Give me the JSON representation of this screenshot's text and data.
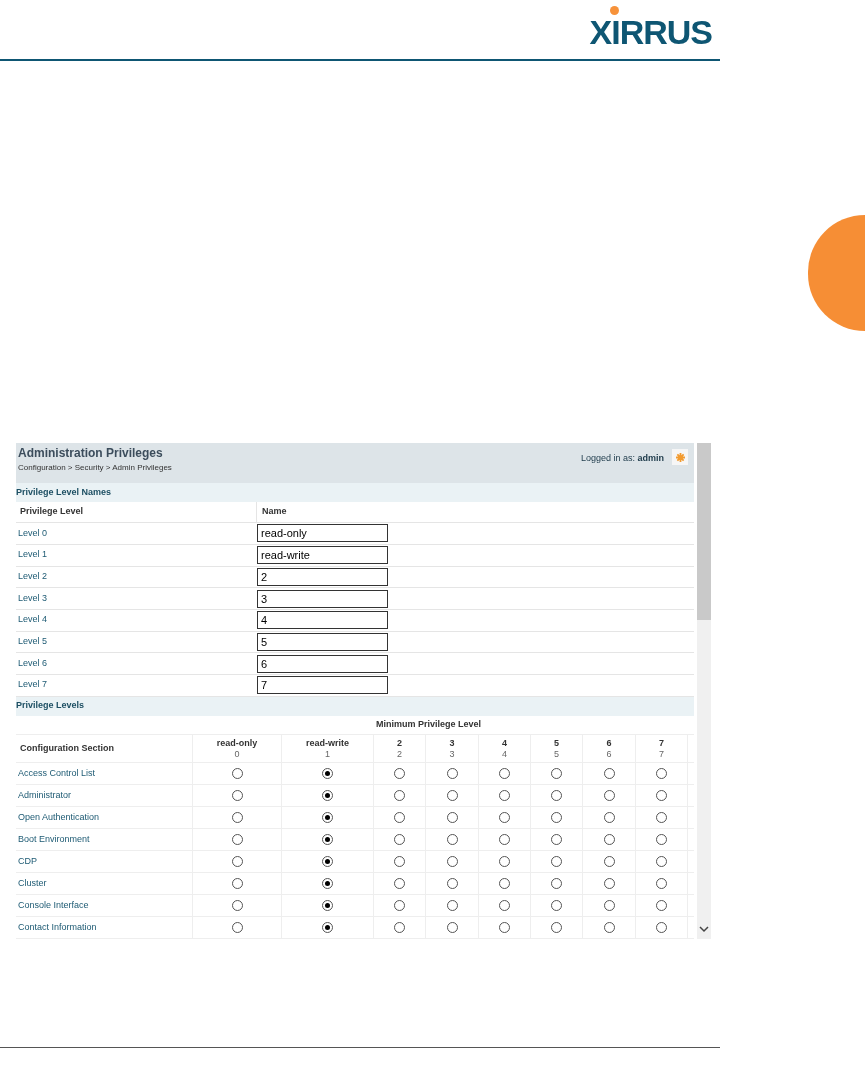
{
  "logo": "XIRRUS",
  "panel": {
    "title": "Administration Privileges",
    "breadcrumb": "Configuration > Security > Admin Privileges",
    "logged_in_label": "Logged in as:",
    "logged_in_user": "admin",
    "names_section": {
      "title": "Privilege Level Names",
      "columns": [
        "Privilege Level",
        "Name"
      ],
      "rows": [
        {
          "level": "Level 0",
          "name": "read-only"
        },
        {
          "level": "Level 1",
          "name": "read-write"
        },
        {
          "level": "Level 2",
          "name": "2"
        },
        {
          "level": "Level 3",
          "name": "3"
        },
        {
          "level": "Level 4",
          "name": "4"
        },
        {
          "level": "Level 5",
          "name": "5"
        },
        {
          "level": "Level 6",
          "name": "6"
        },
        {
          "level": "Level 7",
          "name": "7"
        }
      ]
    },
    "levels_section": {
      "title": "Privilege Levels",
      "group_header": "Minimum Privilege Level",
      "first_column": "Configuration Section",
      "columns": [
        {
          "name": "read-only",
          "number": "0"
        },
        {
          "name": "read-write",
          "number": "1"
        },
        {
          "name": "2",
          "number": "2"
        },
        {
          "name": "3",
          "number": "3"
        },
        {
          "name": "4",
          "number": "4"
        },
        {
          "name": "5",
          "number": "5"
        },
        {
          "name": "6",
          "number": "6"
        },
        {
          "name": "7",
          "number": "7"
        }
      ],
      "rows": [
        {
          "section": "Access Control List",
          "options": [
            {
              "selected": false
            },
            {
              "selected": true
            },
            {
              "selected": false
            },
            {
              "selected": false
            },
            {
              "selected": false
            },
            {
              "selected": false
            },
            {
              "selected": false
            },
            {
              "selected": false
            }
          ]
        },
        {
          "section": "Administrator",
          "options": [
            {
              "selected": false
            },
            {
              "selected": true
            },
            {
              "selected": false
            },
            {
              "selected": false
            },
            {
              "selected": false
            },
            {
              "selected": false
            },
            {
              "selected": false
            },
            {
              "selected": false
            }
          ]
        },
        {
          "section": "Open Authentication",
          "options": [
            {
              "selected": false
            },
            {
              "selected": true
            },
            {
              "selected": false
            },
            {
              "selected": false
            },
            {
              "selected": false
            },
            {
              "selected": false
            },
            {
              "selected": false
            },
            {
              "selected": false
            }
          ]
        },
        {
          "section": "Boot Environment",
          "options": [
            {
              "selected": false
            },
            {
              "selected": true
            },
            {
              "selected": false
            },
            {
              "selected": false
            },
            {
              "selected": false
            },
            {
              "selected": false
            },
            {
              "selected": false
            },
            {
              "selected": false
            }
          ]
        },
        {
          "section": "CDP",
          "options": [
            {
              "selected": false
            },
            {
              "selected": true
            },
            {
              "selected": false
            },
            {
              "selected": false
            },
            {
              "selected": false
            },
            {
              "selected": false
            },
            {
              "selected": false
            },
            {
              "selected": false
            }
          ]
        },
        {
          "section": "Cluster",
          "options": [
            {
              "selected": false
            },
            {
              "selected": true
            },
            {
              "selected": false
            },
            {
              "selected": false
            },
            {
              "selected": false
            },
            {
              "selected": false
            },
            {
              "selected": false
            },
            {
              "selected": false
            }
          ]
        },
        {
          "section": "Console Interface",
          "options": [
            {
              "selected": false
            },
            {
              "selected": true
            },
            {
              "selected": false
            },
            {
              "selected": false
            },
            {
              "selected": false
            },
            {
              "selected": false
            },
            {
              "selected": false
            },
            {
              "selected": false
            }
          ]
        },
        {
          "section": "Contact Information",
          "options": [
            {
              "selected": false
            },
            {
              "selected": true
            },
            {
              "selected": false
            },
            {
              "selected": false
            },
            {
              "selected": false
            },
            {
              "selected": false
            },
            {
              "selected": false
            },
            {
              "selected": false
            }
          ]
        }
      ]
    }
  }
}
